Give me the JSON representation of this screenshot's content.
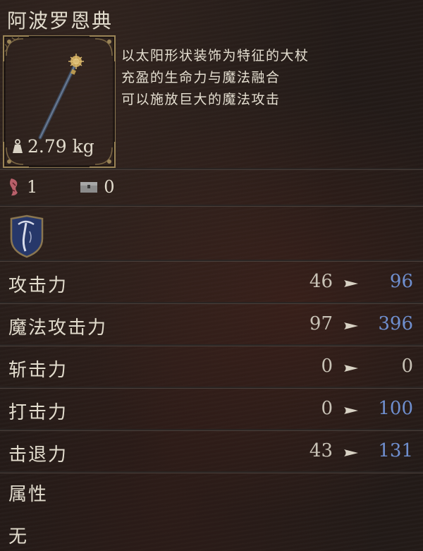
{
  "item": {
    "name": "阿波罗恩典",
    "weight": "2.79 kg",
    "description": [
      "以太阳形状装饰为特征的大杖",
      "充盈的生命力与魔法融合",
      "可以施放巨大的魔法攻击"
    ]
  },
  "requirements": {
    "attunement_slots": "1",
    "storage": "0"
  },
  "stats": [
    {
      "label": "攻击力",
      "before": "46",
      "after": "96",
      "after_state": "up"
    },
    {
      "label": "魔法攻击力",
      "before": "97",
      "after": "396",
      "after_state": "up"
    },
    {
      "label": "斩击力",
      "before": "0",
      "after": "0",
      "after_state": "same"
    },
    {
      "label": "打击力",
      "before": "0",
      "after": "100",
      "after_state": "up"
    },
    {
      "label": "击退力",
      "before": "43",
      "after": "131",
      "after_state": "up"
    }
  ],
  "attribute": {
    "label": "属性",
    "value": "无"
  },
  "colors": {
    "increase": "#6f8fcf",
    "gold_frame": "#8a7650",
    "text": "#e2dccd"
  }
}
